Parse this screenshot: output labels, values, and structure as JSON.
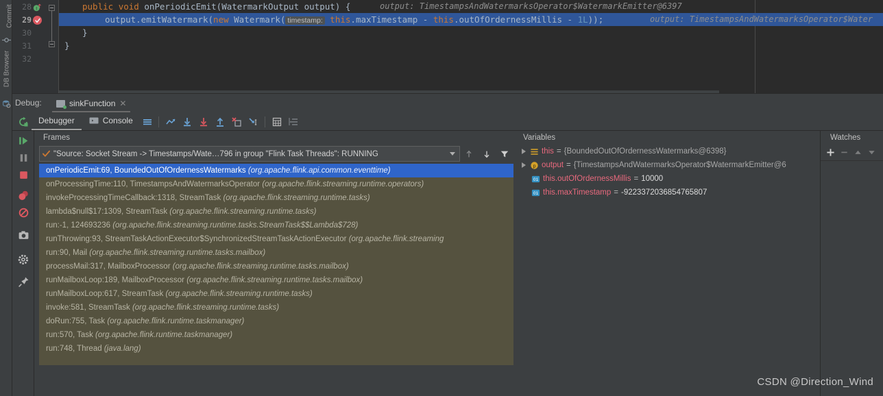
{
  "left_rail": {
    "labels": [
      "Commit",
      "DB Browser"
    ],
    "icons": [
      "commit-icon",
      "db-browser-icon"
    ]
  },
  "editor": {
    "lines": [
      {
        "number": "28",
        "gutter_icon": "method-override-icon"
      },
      {
        "number": "29",
        "gutter_icon": "breakpoint-verified-icon"
      },
      {
        "number": "30",
        "gutter_icon": ""
      },
      {
        "number": "31",
        "gutter_icon": ""
      },
      {
        "number": "32",
        "gutter_icon": ""
      }
    ],
    "line28": {
      "kw_public": "public",
      "kw_void": "void",
      "signature": " onPeriodicEmit(WatermarkOutput output) { ",
      "inline_hint": "output: TimestampsAndWatermarksOperator$WatermarkEmitter@6397"
    },
    "line29": {
      "part1": "output.emitWatermark(",
      "kw_new": "new",
      "part2": " Watermark(",
      "param_hint": "timestamp:",
      "part3": " this",
      "part4": ".maxTimestamp - ",
      "kw_this2": "this",
      "part5": ".outOfOrdernessMillis - ",
      "num": "1L",
      "part6": "));",
      "inline_hint": "output: TimestampsAndWatermarksOperator$Water"
    },
    "line30": "}",
    "line31": "}",
    "line32": ""
  },
  "debug_header": {
    "label": "Debug:",
    "config_tab": {
      "icon": "run-configuration-icon",
      "name": "sinkFunction",
      "close_icon": "close-icon"
    }
  },
  "debug_toolbar": {
    "rerun_icon": "rerun-icon",
    "tabs": [
      {
        "label": "Debugger",
        "icon": "",
        "active": true
      },
      {
        "label": "Console",
        "icon": "console-icon",
        "active": false
      }
    ],
    "buttons": [
      {
        "name": "layout-settings-icon"
      },
      {
        "name": "show-execution-point-icon"
      },
      {
        "name": "step-over-icon"
      },
      {
        "name": "step-into-icon"
      },
      {
        "name": "step-out-icon"
      },
      {
        "name": "force-step-into-icon"
      },
      {
        "name": "run-to-cursor-icon"
      },
      {
        "name": "evaluate-expression-icon"
      },
      {
        "name": "mute-breakpoints-icon"
      }
    ]
  },
  "side_tools": {
    "buttons": [
      {
        "name": "resume-program-icon"
      },
      {
        "name": "pause-program-icon"
      },
      {
        "name": "stop-icon"
      },
      {
        "name": "view-breakpoints-icon"
      },
      {
        "name": "mute-breakpoints-icon"
      },
      {
        "name": "screenshot-icon"
      },
      {
        "name": "settings-gear-icon"
      },
      {
        "name": "pin-tab-icon"
      }
    ]
  },
  "frames_panel": {
    "title": "Frames",
    "thread_selector": {
      "status_icon": "thread-running-check-icon",
      "value": "\"Source: Socket Stream -> Timestamps/Wate…796 in group \"Flink Task Threads\": RUNNING",
      "dropdown_icon": "chevron-down-icon"
    },
    "toolbar": [
      {
        "name": "move-up-icon"
      },
      {
        "name": "move-down-icon"
      },
      {
        "name": "filter-icon"
      }
    ],
    "frames": [
      {
        "method": "onPeriodicEmit:69, BoundedOutOfOrdernessWatermarks",
        "package": "(org.apache.flink.api.common.eventtime)",
        "selected": true
      },
      {
        "method": "onProcessingTime:110, TimestampsAndWatermarksOperator",
        "package": "(org.apache.flink.streaming.runtime.operators)",
        "selected": false
      },
      {
        "method": "invokeProcessingTimeCallback:1318, StreamTask",
        "package": "(org.apache.flink.streaming.runtime.tasks)",
        "selected": false
      },
      {
        "method": "lambda$null$17:1309, StreamTask",
        "package": "(org.apache.flink.streaming.runtime.tasks)",
        "selected": false
      },
      {
        "method": "run:-1, 124693236",
        "package": "(org.apache.flink.streaming.runtime.tasks.StreamTask$$Lambda$728)",
        "selected": false
      },
      {
        "method": "runThrowing:93, StreamTaskActionExecutor$SynchronizedStreamTaskActionExecutor",
        "package": "(org.apache.flink.streaming",
        "selected": false
      },
      {
        "method": "run:90, Mail",
        "package": "(org.apache.flink.streaming.runtime.tasks.mailbox)",
        "selected": false
      },
      {
        "method": "processMail:317, MailboxProcessor",
        "package": "(org.apache.flink.streaming.runtime.tasks.mailbox)",
        "selected": false
      },
      {
        "method": "runMailboxLoop:189, MailboxProcessor",
        "package": "(org.apache.flink.streaming.runtime.tasks.mailbox)",
        "selected": false
      },
      {
        "method": "runMailboxLoop:617, StreamTask",
        "package": "(org.apache.flink.streaming.runtime.tasks)",
        "selected": false
      },
      {
        "method": "invoke:581, StreamTask",
        "package": "(org.apache.flink.streaming.runtime.tasks)",
        "selected": false
      },
      {
        "method": "doRun:755, Task",
        "package": "(org.apache.flink.runtime.taskmanager)",
        "selected": false
      },
      {
        "method": "run:570, Task",
        "package": "(org.apache.flink.runtime.taskmanager)",
        "selected": false
      },
      {
        "method": "run:748, Thread",
        "package": "(java.lang)",
        "selected": false
      }
    ]
  },
  "variables_panel": {
    "title": "Variables",
    "rows": [
      {
        "expandable": true,
        "icon": "object-value-icon",
        "name": "this",
        "eq": "=",
        "value": "{BoundedOutOfOrdernessWatermarks@6398}",
        "value_kind": "object"
      },
      {
        "expandable": true,
        "icon": "parameter-value-icon",
        "name": "output",
        "eq": "=",
        "value": "{TimestampsAndWatermarksOperator$WatermarkEmitter@6",
        "value_kind": "object"
      },
      {
        "expandable": false,
        "icon": "primitive-field-icon",
        "name": "this.outOfOrdernessMillis",
        "eq": "=",
        "value": "10000",
        "value_kind": "number"
      },
      {
        "expandable": false,
        "icon": "primitive-field-icon",
        "name": "this.maxTimestamp",
        "eq": "=",
        "value": "-9223372036854765807",
        "value_kind": "number"
      }
    ]
  },
  "watches_panel": {
    "title": "Watches",
    "buttons": [
      {
        "name": "add-watch-icon",
        "glyph": "+"
      },
      {
        "name": "remove-watch-icon",
        "glyph": "−"
      },
      {
        "name": "move-watch-up-icon",
        "glyph": "▲"
      },
      {
        "name": "move-watch-down-icon",
        "glyph": "▼"
      }
    ]
  },
  "watermark": {
    "text": "CSDN @Direction_Wind"
  },
  "colors": {
    "editor_bg": "#2b2b2b",
    "gutter_bg": "#313335",
    "panel_bg": "#3c3f41",
    "frames_bg": "#55523f",
    "selection_blue": "#2f5699",
    "frame_selected": "#2f65ca",
    "keyword_orange": "#cc7832",
    "number_blue": "#6897bb",
    "var_name_red": "#e8697d",
    "breakpoint_red": "#db5860",
    "run_green": "#59a869"
  }
}
